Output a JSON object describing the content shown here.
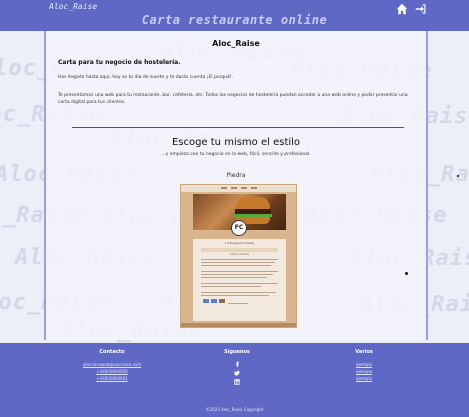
{
  "header": {
    "brand": "Aloc_Raise",
    "site_title": "Carta restaurante online",
    "icons": {
      "home": "home-icon",
      "login": "sign-in-icon"
    }
  },
  "watermark_text": "Aloc_Raise",
  "intro": {
    "title": "Aloc_Raise",
    "heading": "Carta para tu negocio de hostelería.",
    "paragraph1": "Has llegado hasta aquí, hoy es tu día de suerte y te darás cuenta ¡El porqué!.",
    "paragraph2": "Te presentamos una web para tu restaurante, bar, cafetería, etc. Todos los negocios de hostelería puedan acceder a una web online y poder presentar una carta digital para tus clientes."
  },
  "styles_section": {
    "heading": "Escoge tu mismo el estilo",
    "subheading": "...y empieza con tu negocio en la web, fácil, sencillo y profesional.",
    "theme_name": "Piedra",
    "preview": {
      "logo_text": "FC",
      "card_title": "La Burguería Fiesta",
      "band_title": "Sobre nosotros"
    }
  },
  "footer": {
    "contact": {
      "heading": "Contacto",
      "email": "alocraiseweb@alocraise.com",
      "phone1": "+34600000000",
      "phone2": "+34600000001"
    },
    "follow": {
      "heading": "Síguenos",
      "icons": [
        "facebook-icon",
        "twitter-icon",
        "linkedin-icon"
      ]
    },
    "misc": {
      "heading": "Varios",
      "links": [
        "ejemplo",
        "ejemplo",
        "ejemplo"
      ]
    },
    "copyright": "©2022 Aloc_Raise Copyright"
  },
  "colors": {
    "header_bg": "#5f68c5",
    "footer_bg": "#5f68c5",
    "page_bg": "#eceef8",
    "watermark": "#d4d7e8"
  }
}
